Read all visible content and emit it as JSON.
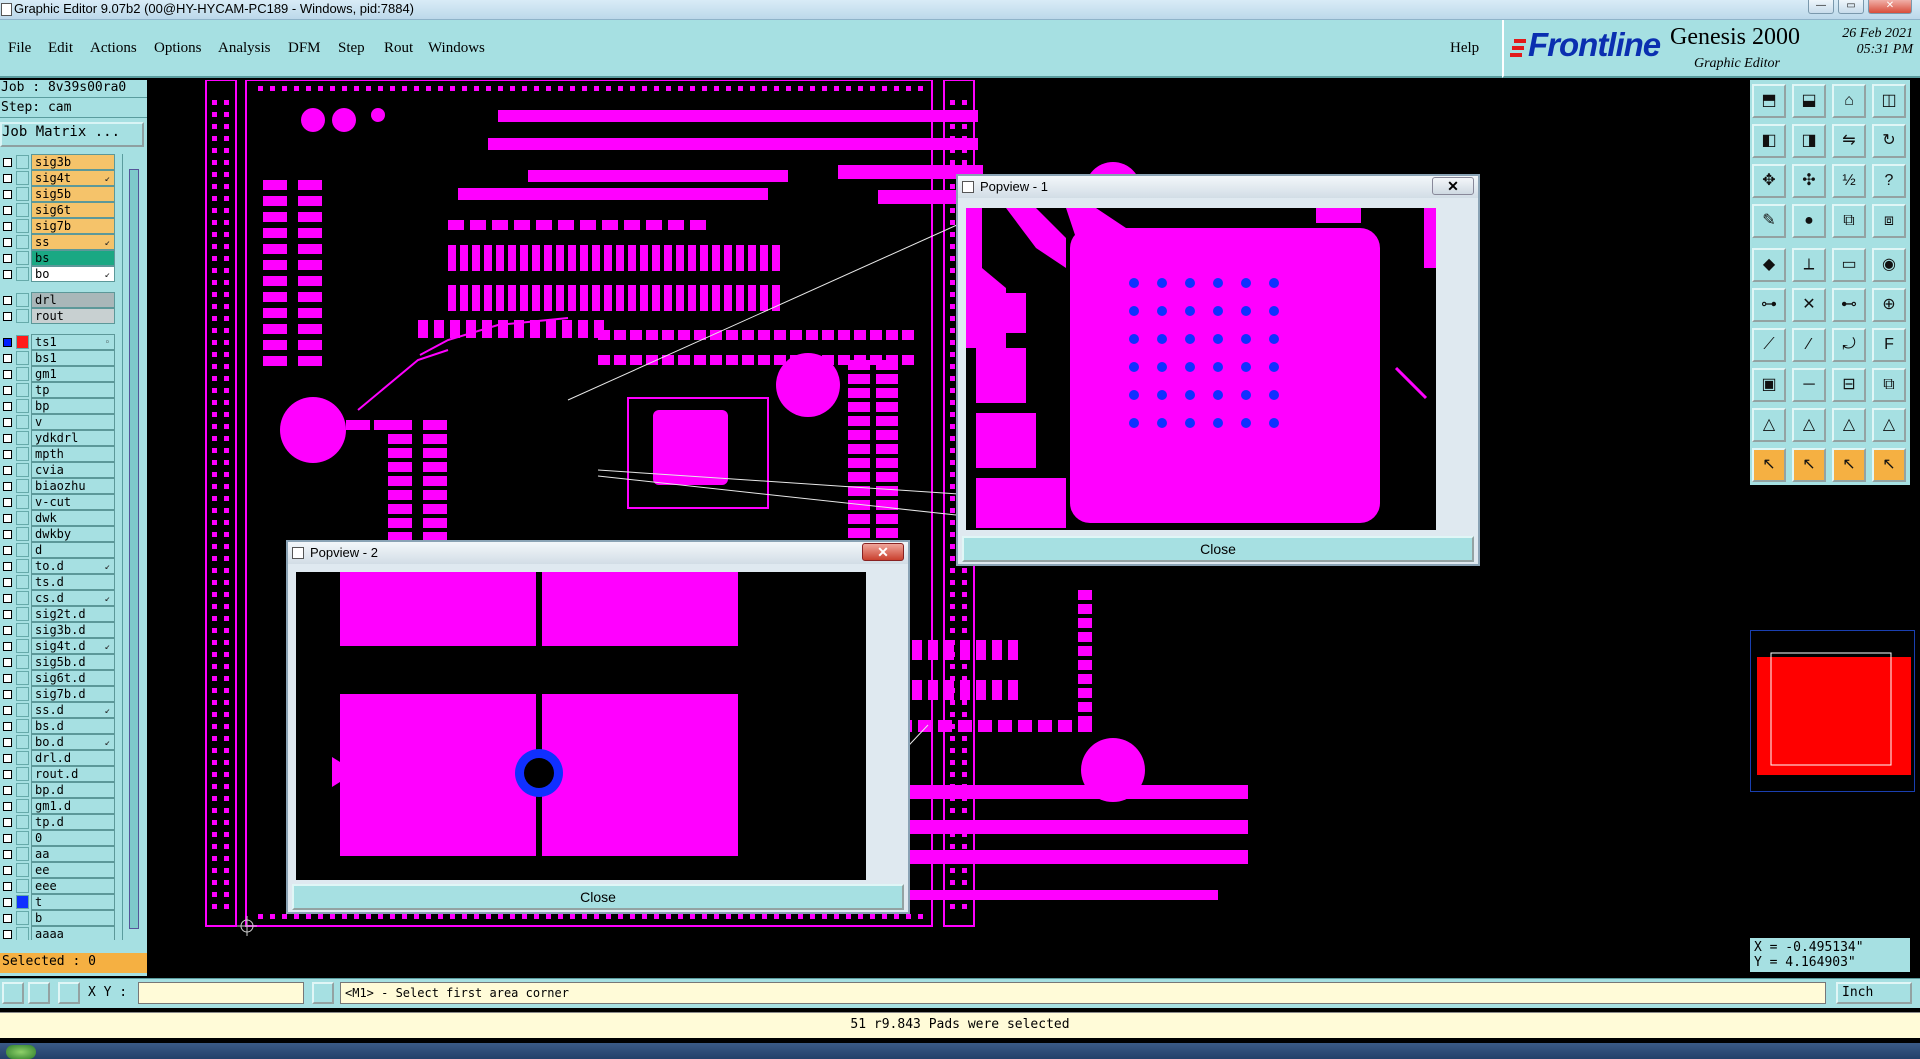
{
  "window": {
    "title": "Graphic Editor 9.07b2 (00@HY-HYCAM-PC189 - Windows, pid:7884)",
    "controls": {
      "minimize": "—",
      "maximize": "▭",
      "close": "✕"
    }
  },
  "menu": {
    "items": [
      "File",
      "Edit",
      "Actions",
      "Options",
      "Analysis",
      "DFM",
      "Step",
      "Rout",
      "Windows"
    ],
    "help": "Help"
  },
  "logo": {
    "brand": "Frontline",
    "product": "Genesis 2000",
    "subtitle": "Graphic Editor",
    "date": "26 Feb 2021",
    "time": "05:31 PM"
  },
  "left": {
    "job": "Job : 8v39s00ra0",
    "step": "Step: cam",
    "job_matrix": "Job Matrix ...",
    "selected": "Selected : 0",
    "layers": [
      {
        "name": "sig3b",
        "bg": "#f5c36a",
        "mark": ""
      },
      {
        "name": "sig4t",
        "bg": "#f5c36a",
        "mark": "↙"
      },
      {
        "name": "sig5b",
        "bg": "#f5c36a",
        "mark": ""
      },
      {
        "name": "sig6t",
        "bg": "#f5c36a",
        "mark": ""
      },
      {
        "name": "sig7b",
        "bg": "#f5c36a",
        "mark": ""
      },
      {
        "name": "ss",
        "bg": "#f5c36a",
        "mark": "↙"
      },
      {
        "name": "bs",
        "bg": "#1aa883",
        "mark": ""
      },
      {
        "name": "bo",
        "bg": "#ffffff",
        "mark": "↙"
      },
      {
        "name": "drl",
        "bg": "#a9b7b9",
        "mark": ""
      },
      {
        "name": "rout",
        "bg": "#c8d0d1",
        "mark": ""
      },
      {
        "name": "ts1",
        "bg": "#a6e0e2",
        "mark": "◦",
        "swatch": "#ff1a1a",
        "cb": "#0020ff"
      },
      {
        "name": "bs1",
        "bg": "#a6e0e2",
        "mark": ""
      },
      {
        "name": "gm1",
        "bg": "#a6e0e2",
        "mark": ""
      },
      {
        "name": "tp",
        "bg": "#a6e0e2",
        "mark": ""
      },
      {
        "name": "bp",
        "bg": "#a6e0e2",
        "mark": ""
      },
      {
        "name": "v",
        "bg": "#a6e0e2",
        "mark": ""
      },
      {
        "name": "ydkdrl",
        "bg": "#a6e0e2",
        "mark": ""
      },
      {
        "name": "mpth",
        "bg": "#a6e0e2",
        "mark": ""
      },
      {
        "name": "cvia",
        "bg": "#a6e0e2",
        "mark": ""
      },
      {
        "name": "biaozhu",
        "bg": "#a6e0e2",
        "mark": ""
      },
      {
        "name": "v-cut",
        "bg": "#a6e0e2",
        "mark": ""
      },
      {
        "name": "dwk",
        "bg": "#a6e0e2",
        "mark": ""
      },
      {
        "name": "dwkby",
        "bg": "#a6e0e2",
        "mark": ""
      },
      {
        "name": "d",
        "bg": "#a6e0e2",
        "mark": ""
      },
      {
        "name": "to.d",
        "bg": "#a6e0e2",
        "mark": "↙"
      },
      {
        "name": "ts.d",
        "bg": "#a6e0e2",
        "mark": ""
      },
      {
        "name": "cs.d",
        "bg": "#a6e0e2",
        "mark": "↙"
      },
      {
        "name": "sig2t.d",
        "bg": "#a6e0e2",
        "mark": ""
      },
      {
        "name": "sig3b.d",
        "bg": "#a6e0e2",
        "mark": ""
      },
      {
        "name": "sig4t.d",
        "bg": "#a6e0e2",
        "mark": "↙"
      },
      {
        "name": "sig5b.d",
        "bg": "#a6e0e2",
        "mark": ""
      },
      {
        "name": "sig6t.d",
        "bg": "#a6e0e2",
        "mark": ""
      },
      {
        "name": "sig7b.d",
        "bg": "#a6e0e2",
        "mark": ""
      },
      {
        "name": "ss.d",
        "bg": "#a6e0e2",
        "mark": "↙"
      },
      {
        "name": "bs.d",
        "bg": "#a6e0e2",
        "mark": ""
      },
      {
        "name": "bo.d",
        "bg": "#a6e0e2",
        "mark": "↙"
      },
      {
        "name": "drl.d",
        "bg": "#a6e0e2",
        "mark": ""
      },
      {
        "name": "rout.d",
        "bg": "#a6e0e2",
        "mark": ""
      },
      {
        "name": "bp.d",
        "bg": "#a6e0e2",
        "mark": ""
      },
      {
        "name": "gm1.d",
        "bg": "#a6e0e2",
        "mark": ""
      },
      {
        "name": "tp.d",
        "bg": "#a6e0e2",
        "mark": ""
      },
      {
        "name": "0",
        "bg": "#a6e0e2",
        "mark": ""
      },
      {
        "name": "aa",
        "bg": "#a6e0e2",
        "mark": ""
      },
      {
        "name": "ee",
        "bg": "#a6e0e2",
        "mark": ""
      },
      {
        "name": "eee",
        "bg": "#a6e0e2",
        "mark": ""
      },
      {
        "name": "t",
        "bg": "#a6e0e2",
        "mark": "",
        "swatch": "#1030ff"
      },
      {
        "name": "b",
        "bg": "#a6e0e2",
        "mark": ""
      },
      {
        "name": "aaaa",
        "bg": "#a6e0e2",
        "mark": ""
      }
    ]
  },
  "right": {
    "coords": {
      "x": "X = -0.495134\"",
      "y": "Y = 4.164903\""
    },
    "tool_icons": [
      "zoom-home-icon",
      "page-down-icon",
      "home-icon",
      "split-view-icon",
      "pan-left-icon",
      "pan-right-icon",
      "mirror-icon",
      "redraw-icon",
      "zoom-fit-icon",
      "zoom-center-icon",
      "scale-1-2-icon",
      "help-query-icon",
      "measure-icon",
      "snap-icon",
      "layer-compare-icon",
      "net-icon",
      "select-point-icon",
      "angle-icon",
      "ruler-icon",
      "circle-select-icon",
      "connect-icon",
      "delete-node-icon",
      "move-node-icon",
      "add-node-icon",
      "line-icon",
      "slope-icon",
      "arc-icon",
      "text-icon",
      "pad-icon",
      "line-mid-icon",
      "segment-icon",
      "copy-icon",
      "triangle-icon",
      "triangle-outline-icon",
      "triangle-base-icon",
      "triangle-flat-icon",
      "pointer-icon",
      "pointer-box-icon",
      "pointer-edit-icon",
      "pointer-multi-icon"
    ],
    "colors": {
      "minimap_board": "#ff0000",
      "minimap_frame": "#1a3fb0"
    }
  },
  "command": {
    "xy_label": "X Y :",
    "xy_value": "",
    "prompt": "<M1> - Select first area corner",
    "units": "Inch"
  },
  "status": "51 r9.843 Pads were selected",
  "popup1": {
    "title": "Popview - 1",
    "close": "Close",
    "close_x": "✕"
  },
  "popup2": {
    "title": "Popview - 2",
    "close": "Close",
    "close_x": "✕"
  },
  "colors": {
    "board": "#ff00ff",
    "via": "#1030ff",
    "panel": "#a6e0e2"
  }
}
